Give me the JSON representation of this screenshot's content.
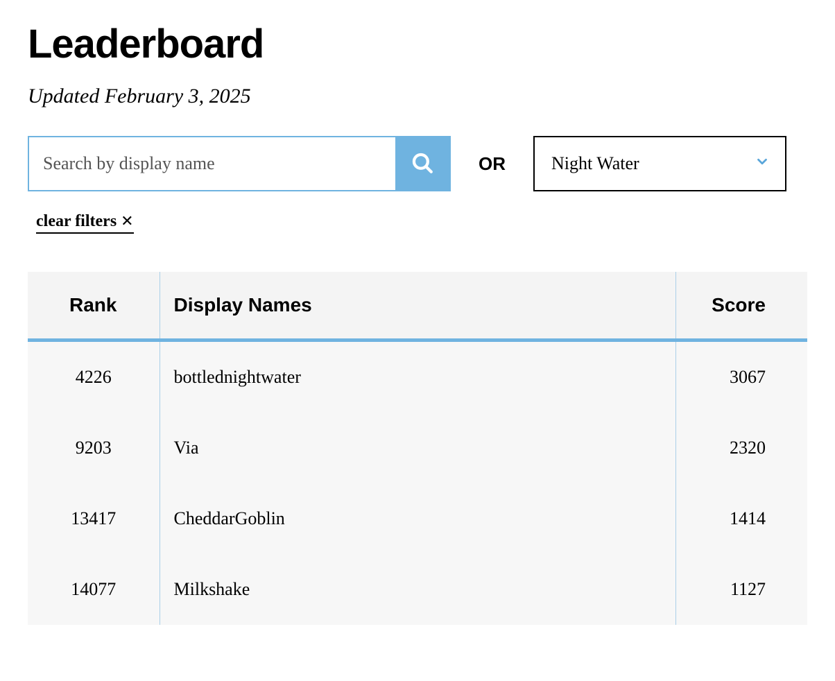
{
  "header": {
    "title": "Leaderboard",
    "updated_prefix": "Updated ",
    "updated_date": "February 3, 2025"
  },
  "controls": {
    "search_placeholder": "Search by display name",
    "or_label": "OR",
    "select_value": "Night Water",
    "clear_filters_label": "clear filters",
    "clear_filters_x": "✕"
  },
  "table": {
    "columns": {
      "rank": "Rank",
      "name": "Display Names",
      "score": "Score"
    },
    "rows": [
      {
        "rank": "4226",
        "name": "bottlednightwater",
        "score": "3067"
      },
      {
        "rank": "9203",
        "name": "Via",
        "score": "2320"
      },
      {
        "rank": "13417",
        "name": "CheddarGoblin",
        "score": "1414"
      },
      {
        "rank": "14077",
        "name": "Milkshake",
        "score": "1127"
      }
    ]
  }
}
